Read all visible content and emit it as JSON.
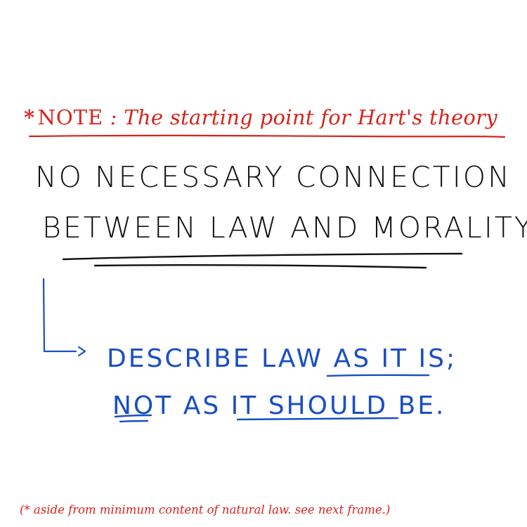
{
  "note": {
    "star": "*",
    "label": "NOTE",
    "separator": " : ",
    "text": "The starting point for Hart's theory"
  },
  "main": {
    "line1": "NO NECESSARY CONNECTION",
    "line2": "BETWEEN LAW AND MORALITY",
    "line2_marker": "*",
    "line2_end": "."
  },
  "arrow_text": {
    "line1_a": "DESCRIBE LAW ",
    "line1_b": "AS IT IS",
    "line1_c": ";",
    "line2_a": "NOT",
    "line2_b": " AS ",
    "line2_c": "IT SHOULD",
    "line2_d": " BE."
  },
  "footnote": "(* aside from minimum content of natural law. see next frame.)",
  "colors": {
    "red": "#d8231c",
    "black": "#111111",
    "blue": "#1a4fc3"
  }
}
